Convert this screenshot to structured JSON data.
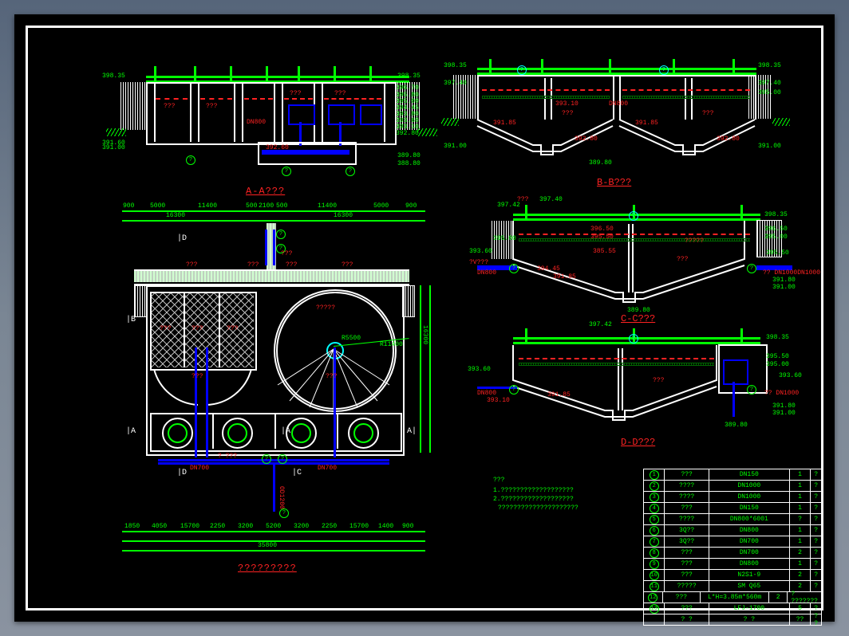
{
  "section_titles": {
    "aa": "A-A???",
    "bb": "B-B???",
    "cc": "C-C???",
    "dd": "D-D???",
    "plan": "?????????"
  },
  "elev": {
    "top1": "398.35",
    "top2": "398.35",
    "e_397_42": "397.42",
    "e_397_40": "397.40",
    "e_396_70": "396.70",
    "e_396_50": "396.50",
    "e_395_80": "395.80",
    "e_395_50": "395.50",
    "e_395_00": "395.00",
    "e_394_45": "394.45",
    "e_393_80": "393.80",
    "e_393_60": "393.60",
    "e_393_10": "393.10",
    "e_392_80": "392.80",
    "e_391_90": "391.90",
    "e_391_85": "391.85",
    "e_391_80": "391.80",
    "e_391_60": "391.60",
    "e_391_00": "391.00",
    "e_389_80": "389.80",
    "e_388_80": "388.80",
    "e_385_55": "385.55"
  },
  "labels": {
    "qmark": "???",
    "q4": "????",
    "q5": "?????",
    "q6": "??????",
    "roll": "?????",
    "dn800": "DN800",
    "dn700": "DN700",
    "dn1000": "DN1000",
    "dn150": "DN150",
    "dn800_6001": "DN800*6001",
    "n2s1_9": "N2S1-9",
    "sm_q65": "SM Q65",
    "lh": "L*H=3.85m*560m",
    "lfj": "LFJ-1700",
    "qv3": "?V???",
    "sq3": "3Q??",
    "node": "?"
  },
  "dims": {
    "d_900": "900",
    "d_5000": "5000",
    "d_11400": "11400",
    "d_2100": "2100",
    "d_500": "500",
    "d_1850": "1850",
    "d_4050": "4050",
    "d_15700": "15700",
    "d_2250": "2250",
    "d_3200": "3200",
    "d_5200": "5200",
    "d_1400": "1400",
    "d_35800": "35800",
    "d_16300": "16300",
    "r_5500": "R5500",
    "r_11400": "R11400",
    "od": "OD1200"
  },
  "notes": {
    "h": "???",
    "n1": "1.???????????????????",
    "n2": "2.???????????????????",
    "q": "?????????????????????"
  },
  "table": {
    "header": [
      "",
      "? ?",
      "? ?",
      "??",
      "? ?"
    ],
    "rows": [
      [
        "1",
        "???",
        "DN150",
        "1",
        "?"
      ],
      [
        "2",
        "????",
        "DN1000",
        "1",
        "?"
      ],
      [
        "3",
        "????",
        "DN1000",
        "1",
        "?"
      ],
      [
        "4",
        "???",
        "DN150",
        "1",
        "?"
      ],
      [
        "5",
        "????",
        "DN800*6001",
        "?",
        "?"
      ],
      [
        "6",
        "3Q??",
        "DN800",
        "1",
        "?"
      ],
      [
        "7",
        "3Q??",
        "DN700",
        "1",
        "?"
      ],
      [
        "8",
        "???",
        "DN700",
        "2",
        "?"
      ],
      [
        "9",
        "???",
        "DN800",
        "1",
        "?"
      ],
      [
        "10",
        "???",
        "N2S1-9",
        "2",
        "?"
      ],
      [
        "11",
        "?????",
        "SM Q65",
        "2",
        "?"
      ],
      [
        "12",
        "???",
        "L*H=3.85m*560m",
        "2",
        "? ???????"
      ],
      [
        "13",
        "???",
        "LFJ-1700",
        "5",
        "?"
      ]
    ]
  },
  "section_marks": {
    "A": "A",
    "B": "B",
    "C": "C",
    "D": "D"
  }
}
